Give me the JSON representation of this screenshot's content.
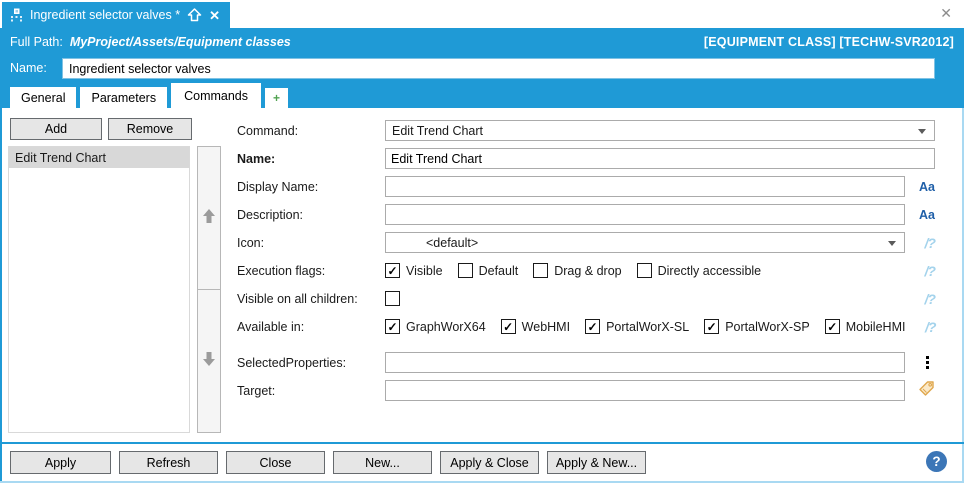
{
  "colors": {
    "accent": "#1f9ad6",
    "light_border": "#a9d9f2",
    "selected_row": "#d8d8d8",
    "button_face": "#e6e6e6",
    "help_blue": "#3c76b7",
    "tag_orange": "#e0a94f",
    "localize_blue": "#1f5fa8",
    "expression_blue": "#a4d3ec"
  },
  "icons": {
    "close": "✕",
    "doc_close": "✕",
    "plus": "+",
    "localize": "Aa",
    "expression": "/?",
    "help": "?"
  },
  "doc_tab": {
    "title": "Ingredient selector valves *"
  },
  "header": {
    "full_path_label": "Full Path:",
    "full_path_value": "MyProject/Assets/Equipment classes",
    "context": "[EQUIPMENT CLASS] [TECHW-SVR2012]",
    "name_label": "Name:",
    "name_value": "Ingredient selector valves"
  },
  "tabs": {
    "items": [
      {
        "label": "General",
        "active": false
      },
      {
        "label": "Parameters",
        "active": false
      },
      {
        "label": "Commands",
        "active": true
      }
    ],
    "plus_label": "+"
  },
  "commands_panel": {
    "add_label": "Add",
    "remove_label": "Remove",
    "items": [
      "Edit Trend Chart"
    ],
    "selected_index": 0
  },
  "form": {
    "command": {
      "label": "Command:",
      "value": "Edit Trend Chart"
    },
    "name": {
      "label": "Name:",
      "value": "Edit Trend Chart"
    },
    "display_name": {
      "label": "Display Name:",
      "value": ""
    },
    "description": {
      "label": "Description:",
      "value": ""
    },
    "icon": {
      "label": "Icon:",
      "value": "<default>"
    },
    "execution_flags": {
      "label": "Execution flags:",
      "options": [
        {
          "label": "Visible",
          "checked": true
        },
        {
          "label": "Default",
          "checked": false
        },
        {
          "label": "Drag & drop",
          "checked": false
        },
        {
          "label": "Directly accessible",
          "checked": false
        }
      ]
    },
    "visible_on_all_children": {
      "label": "Visible on all children:",
      "checked": false
    },
    "available_in": {
      "label": "Available in:",
      "options": [
        {
          "label": "GraphWorX64",
          "checked": true
        },
        {
          "label": "WebHMI",
          "checked": true
        },
        {
          "label": "PortalWorX-SL",
          "checked": true
        },
        {
          "label": "PortalWorX-SP",
          "checked": true
        },
        {
          "label": "MobileHMI",
          "checked": true
        }
      ]
    },
    "selected_properties": {
      "label": "SelectedProperties:",
      "value": ""
    },
    "target": {
      "label": "Target:",
      "value": ""
    }
  },
  "footer": {
    "buttons": [
      "Apply",
      "Refresh",
      "Close",
      "New...",
      "Apply & Close",
      "Apply & New..."
    ]
  }
}
